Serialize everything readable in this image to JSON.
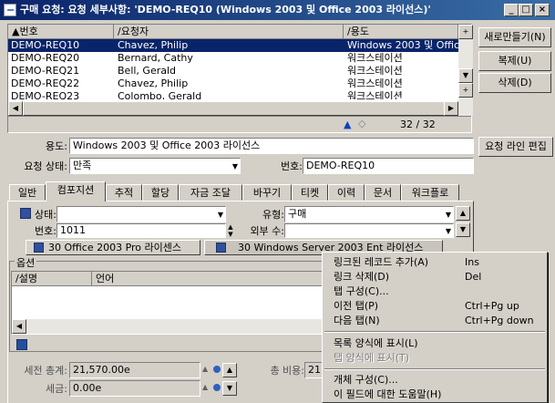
{
  "window": {
    "title": "구매 요청: 요청 세부사항: 'DEMO-REQ10 (Windows 2003 및 Office 2003 라이선스)'",
    "controls": [
      "_",
      "□",
      "×"
    ]
  },
  "list": {
    "columns": [
      "번호",
      "요청자",
      "용도"
    ],
    "rows": [
      {
        "id": "DEMO-REQ10",
        "requester": "Chavez, Philip",
        "purpose": "Windows 2003 및 Offic"
      },
      {
        "id": "DEMO-REQ20",
        "requester": "Bernard, Cathy",
        "purpose": "워크스테이션"
      },
      {
        "id": "DEMO-REQ21",
        "requester": "Bell, Gerald",
        "purpose": "워크스테이션"
      },
      {
        "id": "DEMO-REQ22",
        "requester": "Chavez, Philip",
        "purpose": "워크스테이션"
      },
      {
        "id": "DEMO-REQ23",
        "requester": "Colombo, Gerald",
        "purpose": "워크스테이션"
      }
    ],
    "counter": "32 / 32"
  },
  "side_buttons": {
    "new": "새로만들기(N)",
    "copy": "복제(U)",
    "delete": "삭제(D)",
    "edit_lines": "요청 라인 편집"
  },
  "detail": {
    "purpose_label": "용도:",
    "purpose_value": "Windows 2003 및 Office 2003 라이선스",
    "status_label": "요청 상태:",
    "status_value": "만족",
    "number_label": "번호:",
    "number_value": "DEMO-REQ10"
  },
  "tabs": [
    "일반",
    "컴포지션",
    "추적",
    "할당",
    "자금 조달",
    "바꾸기",
    "티켓",
    "이력",
    "문서",
    "워크플로"
  ],
  "composition": {
    "state_label": "상태:",
    "state_value": "",
    "type_label": "유형:",
    "type_value": "구매",
    "number_label": "번호:",
    "number_value": "1011",
    "outside_label": "외부 수:",
    "outside_value": "",
    "subtab_1": "30 Office 2003 Pro 라이센스",
    "subtab_2": "30 Windows Server 2003 Ent 라이선스",
    "options_label": "옵션",
    "options_cols": [
      "설명",
      "언어"
    ],
    "pretax_label": "세전 총계:",
    "pretax_value": "21,570.00e",
    "tax_label": "세금:",
    "tax_value": "0.00e",
    "total_cost_label": "총 비용:",
    "total_cost_value": "21,5"
  },
  "context_menu": {
    "items": [
      {
        "label": "링크된 레코드 추가(A)",
        "shortcut": "Ins",
        "disabled": false
      },
      {
        "label": "링크 삭제(D)",
        "shortcut": "Del",
        "disabled": false
      },
      {
        "label": "탭 구성(C)...",
        "shortcut": "",
        "disabled": false
      },
      {
        "label": "이전 탭(P)",
        "shortcut": "Ctrl+Pg up",
        "disabled": false
      },
      {
        "label": "다음 탭(N)",
        "shortcut": "Ctrl+Pg down",
        "disabled": false
      },
      {
        "label": "목록 양식에 표시(L)",
        "shortcut": "",
        "disabled": false
      },
      {
        "label": "탭 양식에 표시(T)",
        "shortcut": "",
        "disabled": true
      },
      {
        "label": "개체 구성(C)...",
        "shortcut": "",
        "disabled": false
      },
      {
        "label": "이 필드에 대한 도움말(H)",
        "shortcut": "",
        "disabled": false
      }
    ]
  },
  "colors": {
    "titlebar": "#0a246a",
    "selection": "#0a246a",
    "face": "#d4d0c8"
  }
}
